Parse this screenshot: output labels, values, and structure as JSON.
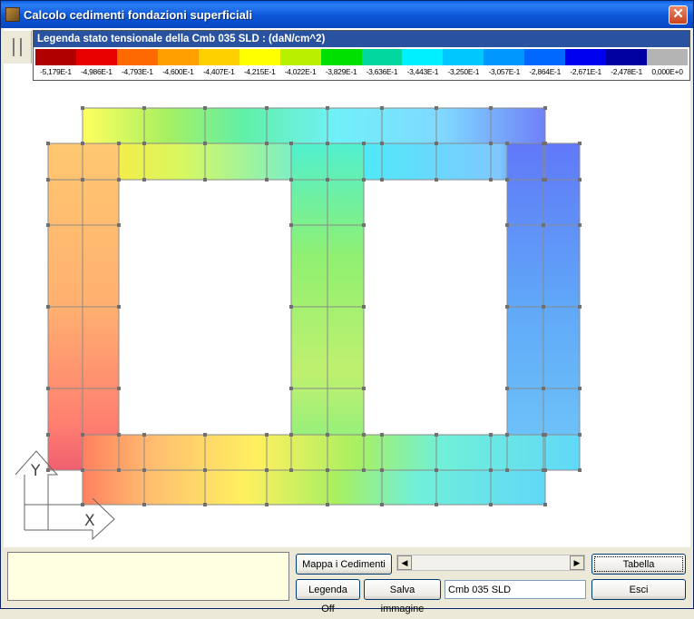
{
  "window": {
    "title": "Calcolo cedimenti fondazioni superficiali",
    "close_label": "✕"
  },
  "legend": {
    "title": "Legenda stato tensionale della Cmb 035 SLD : (daN/cm^2)",
    "colors": [
      "#B00000",
      "#E80000",
      "#FF6A00",
      "#FFA000",
      "#FFD000",
      "#FFFF00",
      "#B8F000",
      "#00E000",
      "#00D8A0",
      "#00F0FF",
      "#00C8FF",
      "#0098FF",
      "#0068FF",
      "#0000F0",
      "#0000A0",
      "#B4B4B4"
    ],
    "labels": [
      "-5,179E-1",
      "-4,986E-1",
      "-4,793E-1",
      "-4,600E-1",
      "-4,407E-1",
      "-4,215E-1",
      "-4,022E-1",
      "-3,829E-1",
      "-3,636E-1",
      "-3,443E-1",
      "-3,250E-1",
      "-3,057E-1",
      "-2,864E-1",
      "-2,671E-1",
      "-2,478E-1",
      "0,000E+0"
    ]
  },
  "axes": {
    "y_label": "Y",
    "x_label": "X"
  },
  "buttons": {
    "map_settlements": "Mappa i Cedimenti",
    "table": "Tabella",
    "legend_off": "Legenda Off",
    "save_image": "Salva immagine",
    "exit": "Esci"
  },
  "combination": {
    "value": "Cmb 035 SLD"
  },
  "scroll": {
    "left_arrow": "◀",
    "right_arrow": "▶"
  }
}
